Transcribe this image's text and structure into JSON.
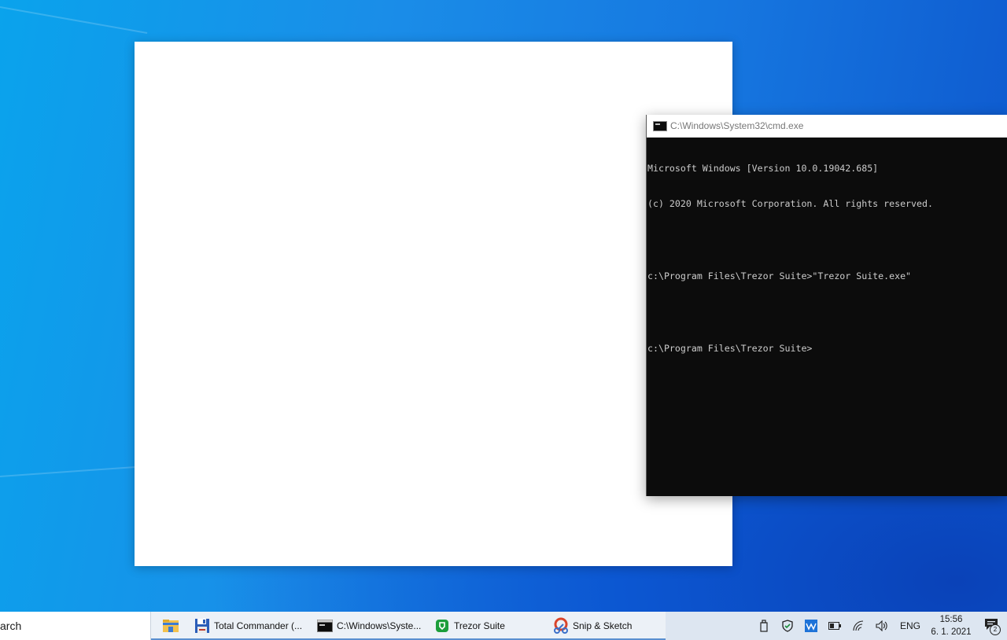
{
  "cmd": {
    "title": "C:\\Windows\\System32\\cmd.exe",
    "lines": [
      "Microsoft Windows [Version 10.0.19042.685]",
      "(c) 2020 Microsoft Corporation. All rights reserved.",
      "",
      "c:\\Program Files\\Trezor Suite>\"Trezor Suite.exe\"",
      "",
      "c:\\Program Files\\Trezor Suite>"
    ]
  },
  "taskbar": {
    "search_text": "arch",
    "apps": [
      {
        "label": "",
        "icon": "file-explorer-icon"
      },
      {
        "label": "Total Commander (...",
        "icon": "floppy-disk-icon"
      },
      {
        "label": "C:\\Windows\\Syste...",
        "icon": "cmd-icon"
      },
      {
        "label": "Trezor Suite",
        "icon": "trezor-shield-icon"
      },
      {
        "label": "Snip & Sketch",
        "icon": "snip-sketch-icon"
      }
    ],
    "tray": {
      "icons": [
        "usb-drive-icon",
        "defender-shield-icon",
        "wave-app-icon",
        "battery-icon",
        "wifi-icon",
        "volume-icon"
      ],
      "language": "ENG",
      "time": "15:56",
      "date": "6. 1. 2021",
      "notification_count": "2"
    }
  },
  "colors": {
    "desktop_left": "#0aa3ec",
    "desktop_right": "#0d55cc",
    "console_bg": "#0c0c0c",
    "console_text": "#cccccc",
    "taskbar_bg": "#dde6f1"
  }
}
